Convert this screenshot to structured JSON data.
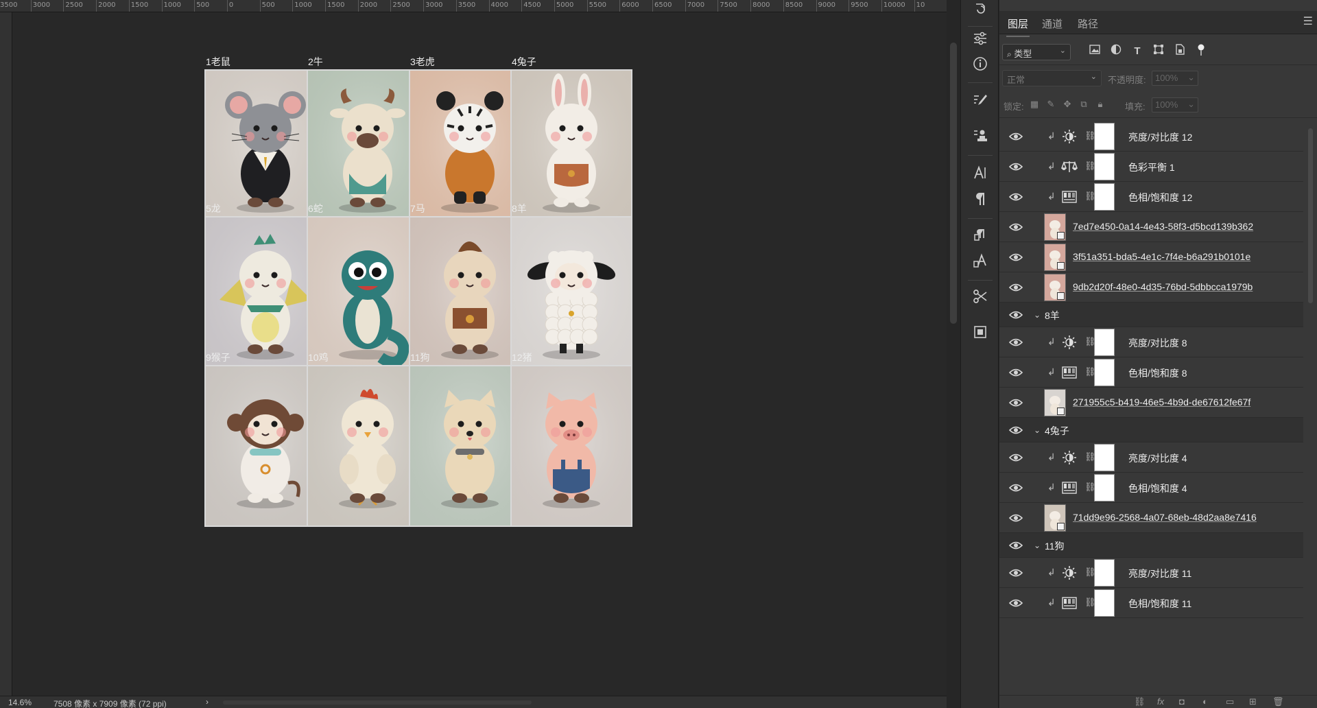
{
  "rulers": {
    "horizontal": [
      "3500",
      "3000",
      "2500",
      "2000",
      "1500",
      "1000",
      "500",
      "0",
      "500",
      "1000",
      "1500",
      "2000",
      "2500",
      "3000",
      "3500",
      "4000",
      "4500",
      "5000",
      "5500",
      "6000",
      "6500",
      "7000",
      "7500",
      "8000",
      "8500",
      "9000",
      "9500",
      "10000",
      "10"
    ]
  },
  "document": {
    "cells": [
      {
        "label": "1老鼠",
        "animal": "rat",
        "bg": "#cfc8c1",
        "body": "#8e9095",
        "accent": "#1f1f22"
      },
      {
        "label": "2牛",
        "animal": "ox",
        "bg": "#b5c2b4",
        "body": "#ebe0cc",
        "accent": "#4f9a8e"
      },
      {
        "label": "3老虎",
        "animal": "tiger",
        "bg": "#d9b9a4",
        "body": "#f2f0ec",
        "accent": "#c9772d"
      },
      {
        "label": "4兔子",
        "animal": "rabbit",
        "bg": "#cbc3b9",
        "body": "#f2ede6",
        "accent": "#b9683e"
      },
      {
        "label": "5龙",
        "animal": "dragon",
        "bg": "#c7c3c6",
        "body": "#eeeadf",
        "accent": "#3f8f76"
      },
      {
        "label": "6蛇",
        "animal": "snake",
        "bg": "#d5c7bd",
        "body": "#2e7c7a",
        "accent": "#eae3d3"
      },
      {
        "label": "7马",
        "animal": "horse",
        "bg": "#cdbfb7",
        "body": "#e8d6bd",
        "accent": "#8a5030"
      },
      {
        "label": "8羊",
        "animal": "sheep",
        "bg": "#d6d2cf",
        "body": "#f2eee8",
        "accent": "#1d1d1d"
      },
      {
        "label": "9猴子",
        "animal": "monkey",
        "bg": "#c9c4bf",
        "body": "#f1ece6",
        "accent": "#6f4a36"
      },
      {
        "label": "10鸡",
        "animal": "chicken",
        "bg": "#c9c4bc",
        "body": "#efe6d4",
        "accent": "#cf4a2e"
      },
      {
        "label": "11狗",
        "animal": "dog",
        "bg": "#b9c4b9",
        "body": "#ead8b9",
        "accent": "#6d6d6d"
      },
      {
        "label": "12猪",
        "animal": "pig",
        "bg": "#cec7c2",
        "body": "#f1b9a8",
        "accent": "#3b5a86"
      }
    ]
  },
  "statusbar": {
    "zoom": "14.6%",
    "info": "7508 像素 x 7909 像素 (72 ppi)",
    "chevron": "›"
  },
  "panel": {
    "tabs": [
      "图层",
      "通道",
      "路径"
    ],
    "active_tab": "图层",
    "filter": {
      "label": "类型"
    },
    "blend": {
      "mode": "正常",
      "opacity_label": "不透明度:",
      "opacity": "100%"
    },
    "lock": {
      "label": "锁定:",
      "fill_label": "填充:",
      "fill": "100%"
    },
    "layers": [
      {
        "kind": "adj",
        "icon": "sun",
        "name": "亮度/对比度 12"
      },
      {
        "kind": "adj",
        "icon": "balance",
        "name": "色彩平衡 1"
      },
      {
        "kind": "adj",
        "icon": "hue",
        "name": "色相/饱和度 12"
      },
      {
        "kind": "smart",
        "animal": "pig",
        "name": "7ed7e450-0a14-4e43-58f3-d5bcd139b362"
      },
      {
        "kind": "smart",
        "animal": "pig",
        "name": "3f51a351-bda5-4e1c-7f4e-b6a291b0101e"
      },
      {
        "kind": "smart",
        "animal": "pig",
        "name": "9db2d20f-48e0-4d35-76bd-5dbbcca1979b"
      },
      {
        "kind": "group",
        "name": "8羊"
      },
      {
        "kind": "adj",
        "icon": "sun",
        "name": "亮度/对比度 8"
      },
      {
        "kind": "adj",
        "icon": "hue",
        "name": "色相/饱和度 8"
      },
      {
        "kind": "smart",
        "animal": "sheep",
        "name": "271955c5-b419-46e5-4b9d-de67612fe67f"
      },
      {
        "kind": "group",
        "name": "4兔子"
      },
      {
        "kind": "adj",
        "icon": "sun",
        "name": "亮度/对比度 4"
      },
      {
        "kind": "adj",
        "icon": "hue",
        "name": "色相/饱和度 4"
      },
      {
        "kind": "smart",
        "animal": "rabbit",
        "name": "71dd9e96-2568-4a07-68eb-48d2aa8e7416"
      },
      {
        "kind": "group",
        "name": "11狗"
      },
      {
        "kind": "adj",
        "icon": "sun",
        "name": "亮度/对比度 11"
      },
      {
        "kind": "adj",
        "icon": "hue",
        "name": "色相/饱和度 11"
      }
    ]
  }
}
